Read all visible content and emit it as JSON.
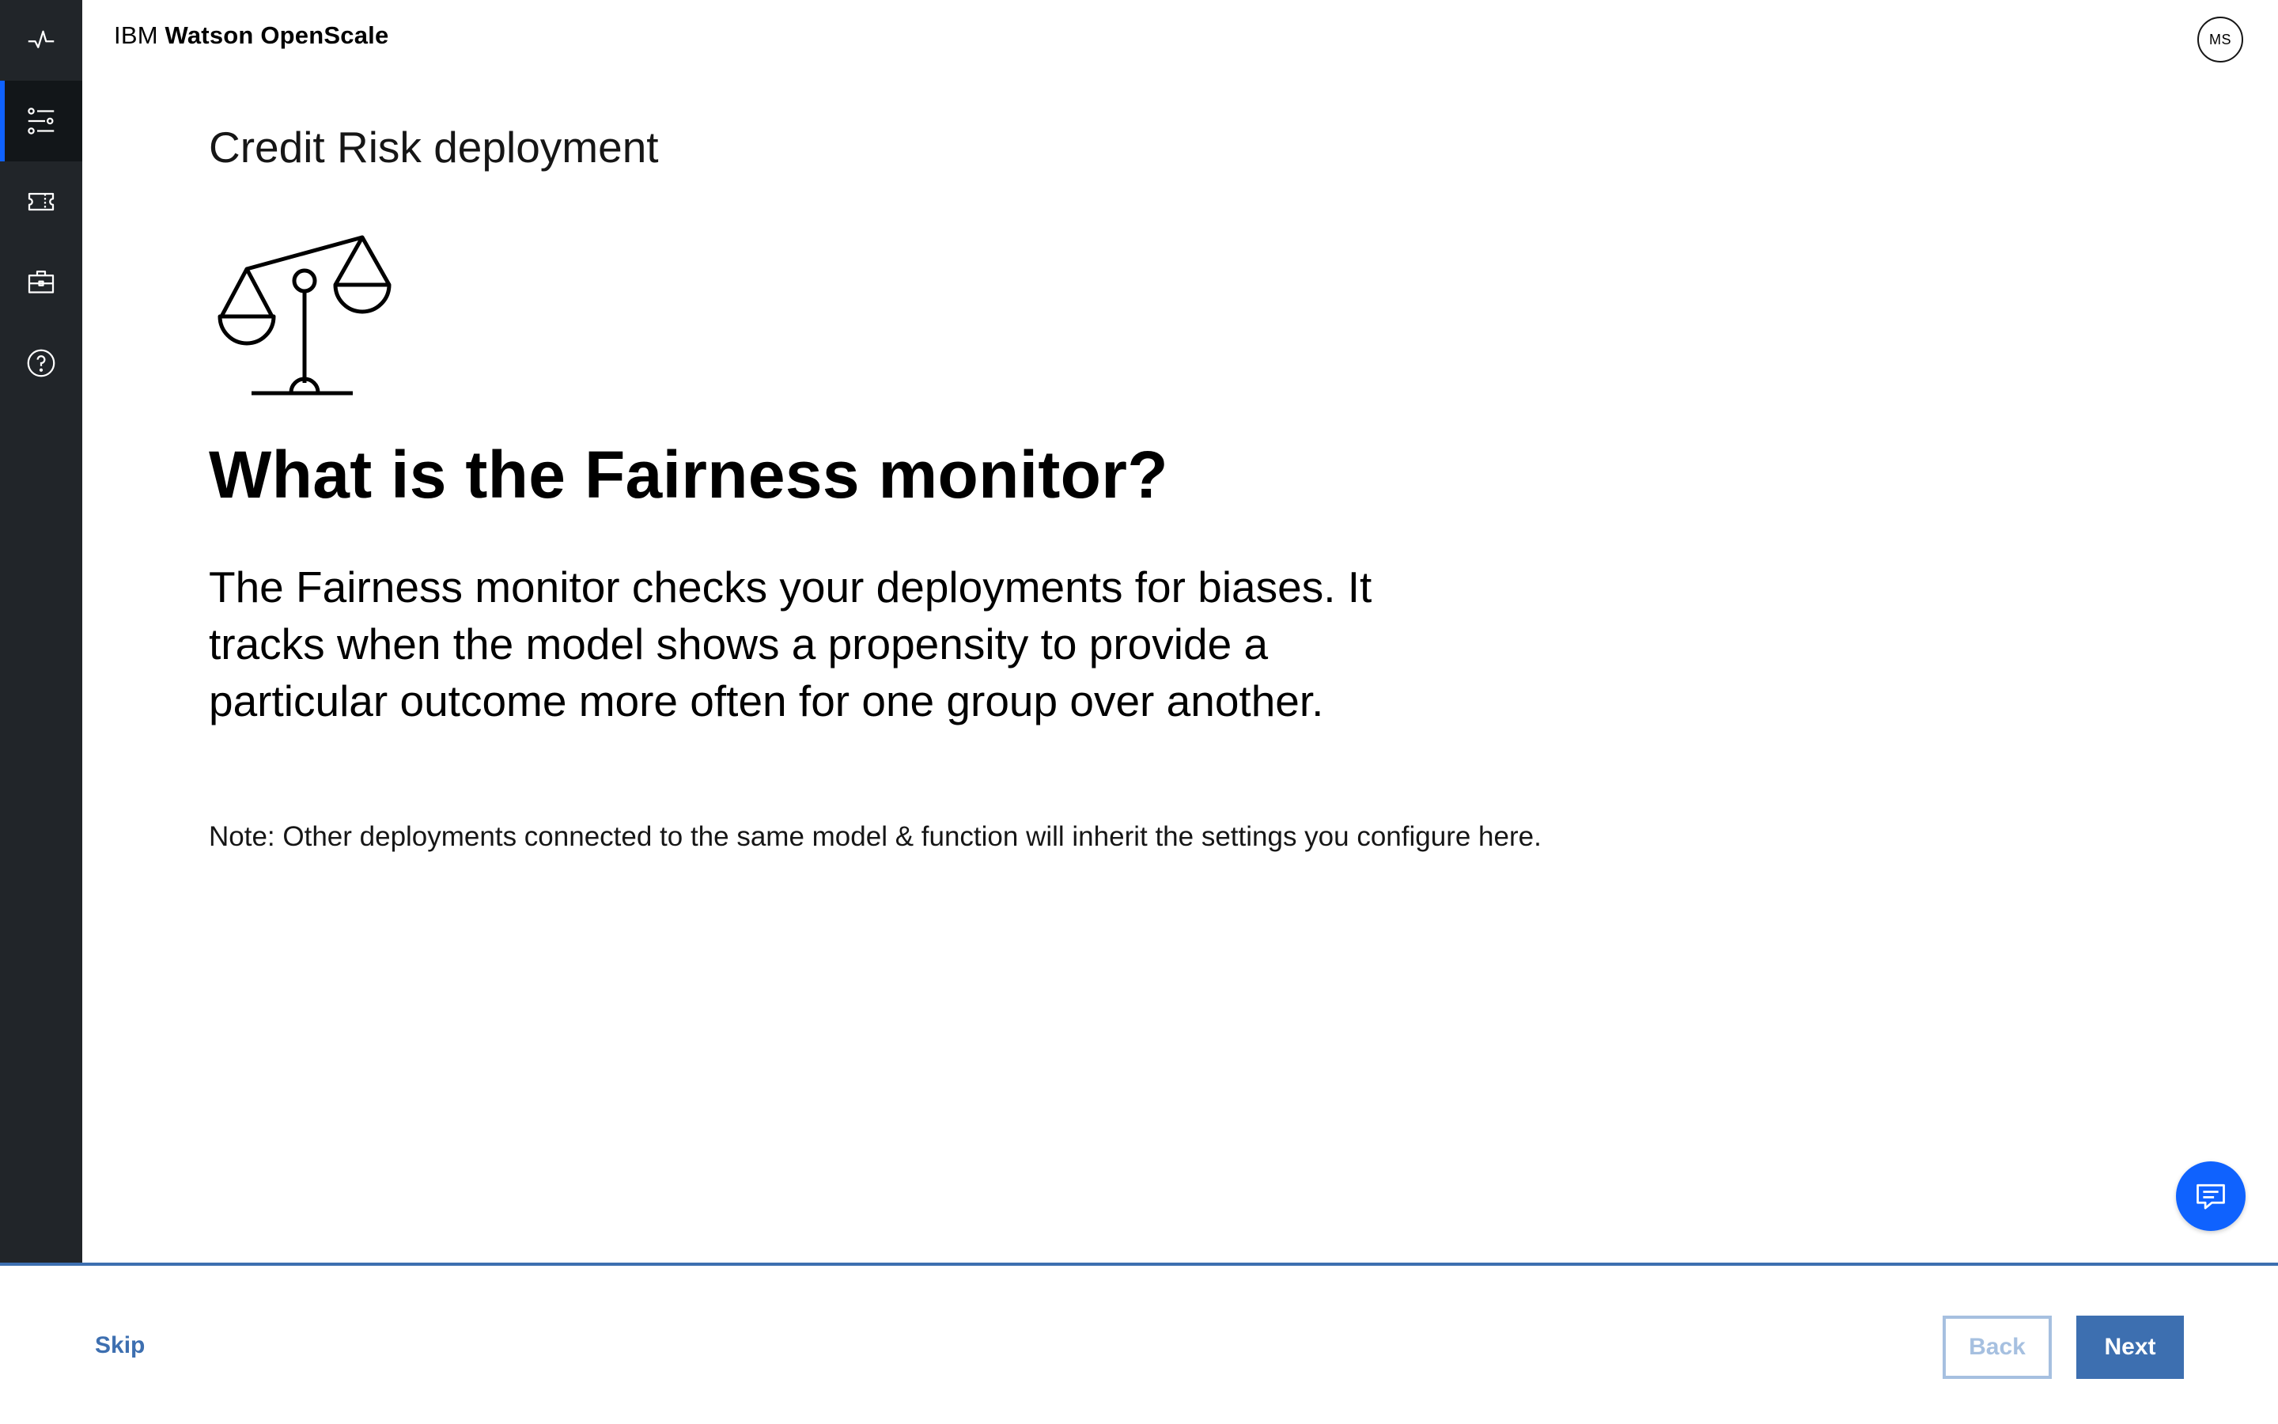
{
  "app": {
    "brand_prefix": "IBM",
    "brand_name": "Watson OpenScale",
    "user_initials": "MS"
  },
  "rail": {
    "items": [
      {
        "icon": "activity-icon",
        "active": false
      },
      {
        "icon": "sliders-icon",
        "active": true
      },
      {
        "icon": "ticket-icon",
        "active": false
      },
      {
        "icon": "briefcase-icon",
        "active": false
      },
      {
        "icon": "help-icon",
        "active": false
      }
    ]
  },
  "main": {
    "deployment_title": "Credit Risk deployment",
    "illustration_icon": "scale-icon",
    "heading": "What is the Fairness monitor?",
    "description_lines": [
      "The Fairness monitor checks your deployments for biases. It",
      "tracks when the model shows a propensity to provide a",
      "particular outcome more often for one group over another."
    ],
    "note": "Note: Other deployments connected to the same model & function will inherit the settings you configure here."
  },
  "chat": {
    "icon": "chat-icon"
  },
  "footer": {
    "skip_label": "Skip",
    "back_label": "Back",
    "next_label": "Next"
  },
  "colors": {
    "rail_bg": "#212529",
    "accent": "#0f62fe",
    "footer_accent": "#3d6fb0",
    "back_disabled": "#a6c0e0"
  }
}
